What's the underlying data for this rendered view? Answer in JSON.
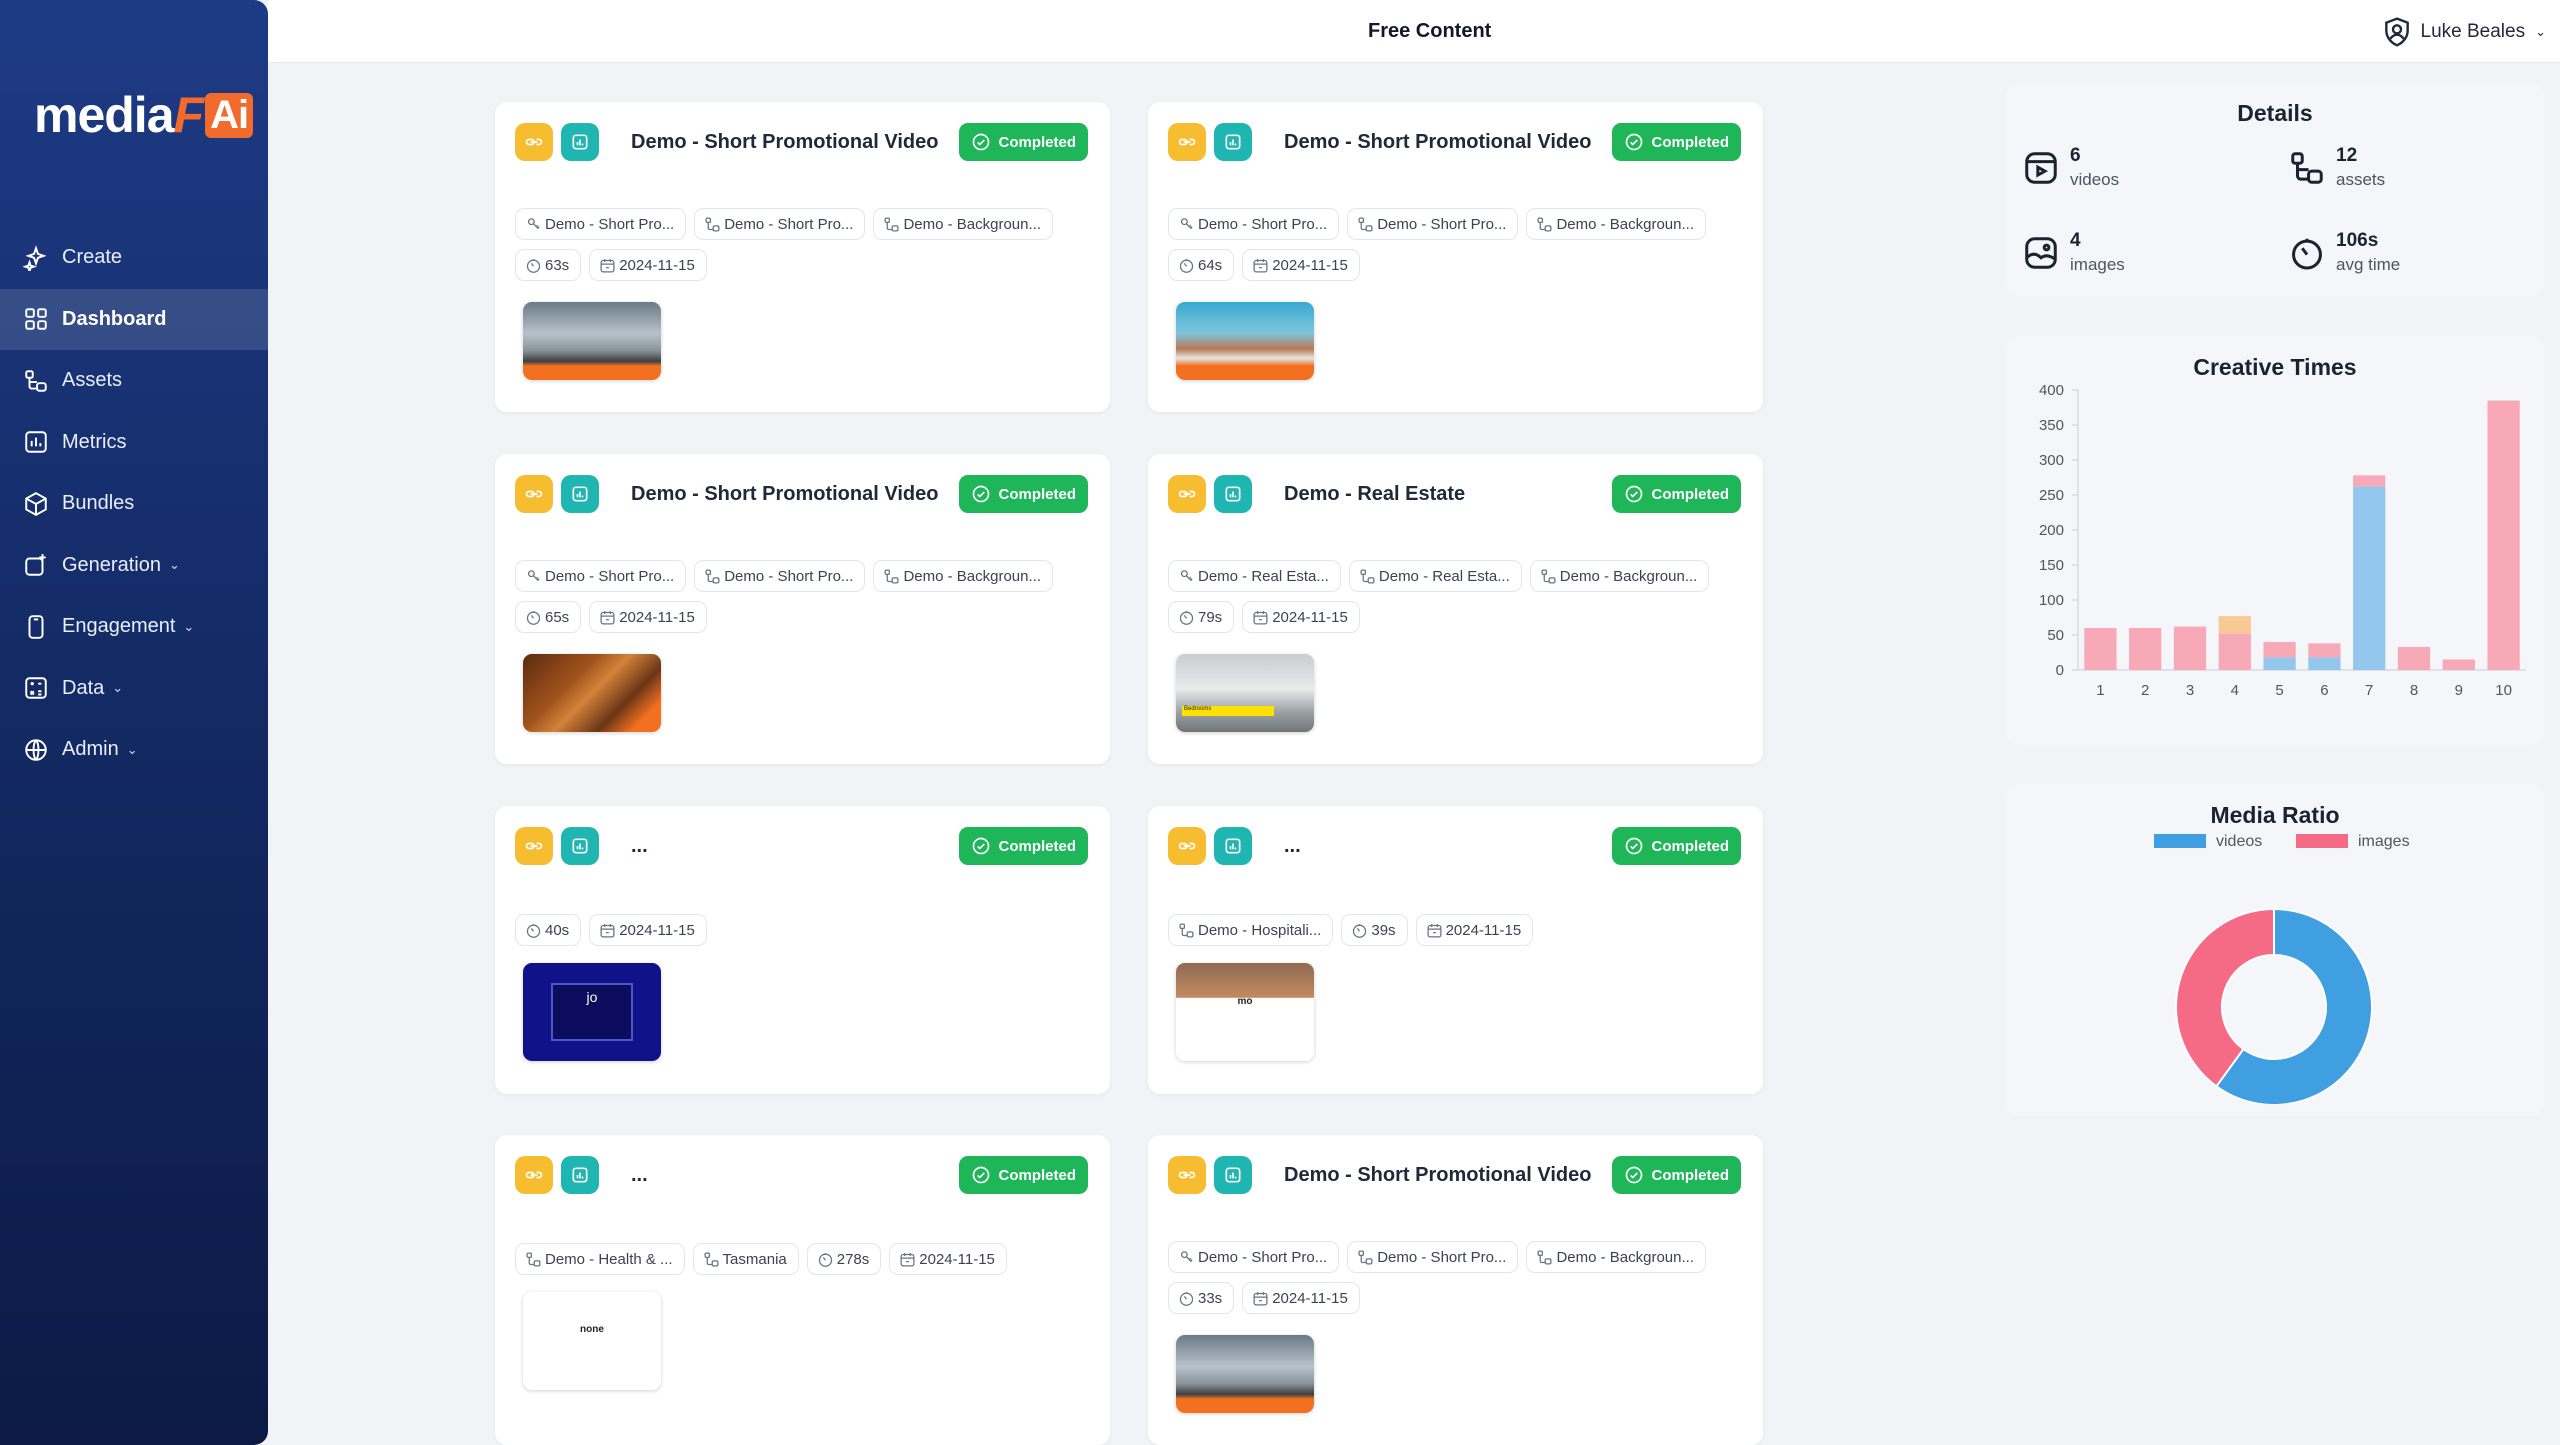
{
  "app": {
    "logo_part1": "media",
    "logo_part2": "F",
    "logo_part3": "Ai"
  },
  "topbar": {
    "title": "Free Content",
    "user_name": "Luke Beales"
  },
  "sidebar": {
    "items": [
      {
        "label": "Create",
        "icon": "sparkle-icon"
      },
      {
        "label": "Dashboard",
        "icon": "grid-icon",
        "active": true
      },
      {
        "label": "Assets",
        "icon": "assets-icon"
      },
      {
        "label": "Metrics",
        "icon": "bar-chart-icon"
      },
      {
        "label": "Bundles",
        "icon": "box-icon"
      },
      {
        "label": "Generation",
        "icon": "generation-icon",
        "chevron": true
      },
      {
        "label": "Engagement",
        "icon": "phone-icon",
        "chevron": true
      },
      {
        "label": "Data",
        "icon": "calculator-icon",
        "chevron": true
      },
      {
        "label": "Admin",
        "icon": "globe-icon",
        "chevron": true
      }
    ]
  },
  "cards": [
    {
      "title": "Demo - Short Promotional Video",
      "status": "Completed",
      "tags": [
        {
          "icon": "lock-icon",
          "text": "Demo - Short Pro..."
        },
        {
          "icon": "asset-icon",
          "text": "Demo - Short Pro..."
        },
        {
          "icon": "asset-icon",
          "text": "Demo - Backgroun..."
        }
      ],
      "meta": [
        {
          "icon": "timer-icon",
          "text": "63s"
        },
        {
          "icon": "calendar-icon",
          "text": "2024-11-15"
        }
      ],
      "thumb": "road"
    },
    {
      "title": "Demo - Short Promotional Video",
      "status": "Completed",
      "tags": [
        {
          "icon": "lock-icon",
          "text": "Demo - Short Pro..."
        },
        {
          "icon": "asset-icon",
          "text": "Demo - Short Pro..."
        },
        {
          "icon": "asset-icon",
          "text": "Demo - Backgroun..."
        }
      ],
      "meta": [
        {
          "icon": "timer-icon",
          "text": "64s"
        },
        {
          "icon": "calendar-icon",
          "text": "2024-11-15"
        }
      ],
      "thumb": "road2"
    },
    {
      "title": "Demo - Short Promotional Video",
      "status": "Completed",
      "tags": [
        {
          "icon": "lock-icon",
          "text": "Demo - Short Pro..."
        },
        {
          "icon": "asset-icon",
          "text": "Demo - Short Pro..."
        },
        {
          "icon": "asset-icon",
          "text": "Demo - Backgroun..."
        }
      ],
      "meta": [
        {
          "icon": "timer-icon",
          "text": "65s"
        },
        {
          "icon": "calendar-icon",
          "text": "2024-11-15"
        }
      ],
      "thumb": "rock"
    },
    {
      "title": "Demo - Real Estate",
      "status": "Completed",
      "tags": [
        {
          "icon": "lock-icon",
          "text": "Demo - Real Esta..."
        },
        {
          "icon": "asset-icon",
          "text": "Demo - Real Esta..."
        },
        {
          "icon": "asset-icon",
          "text": "Demo - Backgroun..."
        }
      ],
      "meta": [
        {
          "icon": "timer-icon",
          "text": "79s"
        },
        {
          "icon": "calendar-icon",
          "text": "2024-11-15"
        }
      ],
      "thumb": "room",
      "thumb_text": "Bedrooms"
    },
    {
      "title": "...",
      "status": "Completed",
      "tags": [],
      "meta": [
        {
          "icon": "timer-icon",
          "text": "40s"
        },
        {
          "icon": "calendar-icon",
          "text": "2024-11-15"
        }
      ],
      "thumb": "blue",
      "thumb_text": "jo"
    },
    {
      "title": "...",
      "status": "Completed",
      "tags": [
        {
          "icon": "asset-icon",
          "text": "Demo - Hospitali..."
        },
        {
          "icon": "timer-icon",
          "text": "39s"
        },
        {
          "icon": "calendar-icon",
          "text": "2024-11-15"
        }
      ],
      "meta": [],
      "thumb": "people",
      "thumb_text": "mo"
    },
    {
      "title": "...",
      "status": "Completed",
      "tags": [
        {
          "icon": "asset-icon",
          "text": "Demo - Health & ..."
        },
        {
          "icon": "asset-icon",
          "text": "Tasmania"
        },
        {
          "icon": "timer-icon",
          "text": "278s"
        },
        {
          "icon": "calendar-icon",
          "text": "2024-11-15"
        }
      ],
      "meta": [],
      "thumb": "white",
      "thumb_text": "none"
    },
    {
      "title": "Demo - Short Promotional Video",
      "status": "Completed",
      "tags": [
        {
          "icon": "lock-icon",
          "text": "Demo - Short Pro..."
        },
        {
          "icon": "asset-icon",
          "text": "Demo - Short Pro..."
        },
        {
          "icon": "asset-icon",
          "text": "Demo - Backgroun..."
        }
      ],
      "meta": [
        {
          "icon": "timer-icon",
          "text": "33s"
        },
        {
          "icon": "calendar-icon",
          "text": "2024-11-15"
        }
      ],
      "thumb": "road"
    }
  ],
  "details": {
    "title": "Details",
    "items": [
      {
        "icon": "video-icon",
        "value": "6",
        "label": "videos"
      },
      {
        "icon": "assets-icon",
        "value": "12",
        "label": "assets"
      },
      {
        "icon": "image-icon",
        "value": "4",
        "label": "images"
      },
      {
        "icon": "timer-icon",
        "value": "106s",
        "label": "avg time"
      }
    ]
  },
  "colors": {
    "accent_orange": "#f26a2c",
    "success": "#1fb65a",
    "badge_yellow": "#f5bd2f",
    "badge_teal": "#1fb5b1",
    "videos_blue": "#3f9fe0",
    "images_pink": "#f56b85"
  },
  "chart_data": [
    {
      "type": "bar",
      "stacked": true,
      "title": "Creative Times",
      "categories": [
        "1",
        "2",
        "3",
        "4",
        "5",
        "6",
        "7",
        "8",
        "9",
        "10"
      ],
      "ylim": [
        0,
        400
      ],
      "yticks": [
        0,
        50,
        100,
        150,
        200,
        250,
        300,
        350,
        400
      ],
      "series": [
        {
          "color": "#93c7ee",
          "values": [
            0,
            0,
            0,
            0,
            18,
            18,
            262,
            0,
            0,
            0
          ]
        },
        {
          "color": "#f7a9b8",
          "values": [
            60,
            60,
            62,
            52,
            22,
            20,
            16,
            33,
            15,
            385
          ]
        },
        {
          "color": "#f9c994",
          "values": [
            0,
            0,
            0,
            25,
            0,
            0,
            0,
            0,
            0,
            0
          ]
        }
      ]
    },
    {
      "type": "pie",
      "donut": true,
      "title": "Media Ratio",
      "labels": [
        "videos",
        "images"
      ],
      "values": [
        6,
        4
      ],
      "colors": [
        "#3f9fe0",
        "#f56b85"
      ],
      "legend": "top"
    }
  ]
}
